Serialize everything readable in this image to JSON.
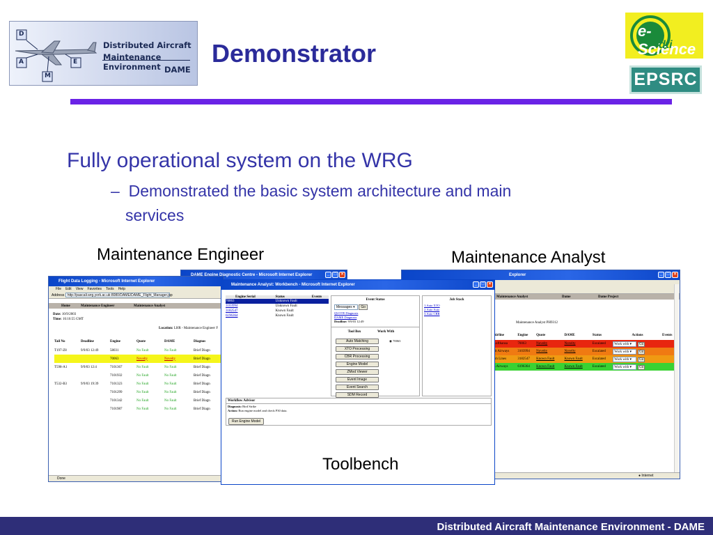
{
  "header": {
    "logo_text": [
      "Distributed Aircraft",
      "Maintenance Environment",
      "DAME"
    ],
    "logo_letters": [
      "D",
      "A",
      "M",
      "E"
    ],
    "title": "Demonstrator",
    "escience": {
      "line1": "e-Science",
      "line2": "dti"
    },
    "epsrc": "EPSRC"
  },
  "bullets": {
    "main": "Fully operational system on the WRG",
    "sub_dash": "–",
    "sub_line1": "Demonstrated the basic system architecture and main",
    "sub_line2": "services"
  },
  "captions": {
    "engineer": "Maintenance Engineer",
    "analyst": "Maintenance Analyst",
    "toolbench": "Toolbench"
  },
  "engineer_window": {
    "title": "Flight Data Logging - Microsoft Internet Explorer",
    "menu": [
      "File",
      "Edit",
      "View",
      "Favorites",
      "Tools",
      "Help"
    ],
    "address_label": "Address",
    "address": "http://pascali.wrg.york.ac.uk:8080/DAME/DAME_Flight_Manager.jsp",
    "nav": [
      "Home",
      "Maintenance Engineer",
      "Maintenance Analyst"
    ],
    "date_label": "Date:",
    "date": "10/9/2003",
    "time_label": "Time:",
    "time": "16:16:55 GMT",
    "location_label": "Location:",
    "location": "LHR - Maintenance Engineer F",
    "columns": [
      "Tail No",
      "Deadline",
      "Engine",
      "Quote",
      "DAME",
      "Diagnos"
    ],
    "rows": [
      {
        "tail": "T197-Z8",
        "deadline": "9/9/03 12:49",
        "engine": "58031",
        "quote": "No Fault",
        "dame": "No Fault",
        "diag": "Brief Diagn",
        "hl": false
      },
      {
        "tail": "",
        "deadline": "",
        "engine": "70063",
        "quote": "Novelty",
        "dame": "Novelty",
        "diag": "Brief Diagn",
        "hl": true
      },
      {
        "tail": "T598-A1",
        "deadline": "9/9/03 12:4",
        "engine": "7101367",
        "quote": "No Fault",
        "dame": "No Fault",
        "diag": "Brief Diagn",
        "hl": false
      },
      {
        "tail": "",
        "deadline": "",
        "engine": "7101932",
        "quote": "No Fault",
        "dame": "No Fault",
        "diag": "Brief Diagn",
        "hl": false
      },
      {
        "tail": "T532-B3",
        "deadline": "9/9/03 19:39",
        "engine": "7101323",
        "quote": "No Fault",
        "dame": "No Fault",
        "diag": "Brief Diagn",
        "hl": false
      },
      {
        "tail": "",
        "deadline": "",
        "engine": "7101299",
        "quote": "No Fault",
        "dame": "No Fault",
        "diag": "Brief Diagn",
        "hl": false
      },
      {
        "tail": "",
        "deadline": "",
        "engine": "7101342",
        "quote": "No Fault",
        "dame": "No Fault",
        "diag": "Brief Diagn",
        "hl": false
      },
      {
        "tail": "",
        "deadline": "",
        "engine": "7101987",
        "quote": "No Fault",
        "dame": "No Fault",
        "diag": "Brief Diagn",
        "hl": false
      }
    ],
    "status": "Done"
  },
  "diag_window": {
    "title": "DAME Engine Diagnostic Centre - Microsoft Internet Explorer"
  },
  "analyst_window": {
    "title": "Explorer",
    "nav": [
      "Maintenance Analyst",
      "Dame",
      "Dame Project"
    ],
    "heading": "Maintenance Analyst PH9312",
    "columns": [
      "Airline",
      "Engine",
      "Quote",
      "DAME",
      "Status",
      "Actions",
      "Events"
    ],
    "rows": [
      {
        "airline": "Lufthansa",
        "engine": "70063",
        "quote": "Novelty",
        "dame": "Novelty",
        "status": "Escalated",
        "action": "Work with",
        "go": "Go",
        "color": "#e8260f"
      },
      {
        "airline": "rit Airways",
        "engine": "3103994",
        "quote": "Novelty",
        "dame": "Novelty",
        "status": "Escalated",
        "action": "Work with",
        "go": "Go",
        "color": "#f07a12"
      },
      {
        "airline": "ish Lines",
        "engine": "3182547",
        "quote": "Known Fault",
        "dame": "Known Fault",
        "status": "Escalated",
        "action": "Work with",
        "go": "Go",
        "color": "#f09a12"
      },
      {
        "airline": "n Airways",
        "engine": "6196364",
        "quote": "Known Fault",
        "dame": "Known Fault",
        "status": "Escalated",
        "action": "Work with",
        "go": "Go",
        "color": "#39d233"
      }
    ],
    "status": "Internet"
  },
  "toolbench_window": {
    "title": "Maintenance Analyst: Workbench - Microsoft Internet Explorer",
    "engine_cols": [
      "Engine Serial",
      "Status",
      "Events"
    ],
    "engines": [
      {
        "serial": "70063",
        "status": "Unknown Fault",
        "sel": true
      },
      {
        "serial": "3103994",
        "status": "Unknown Fault",
        "sel": false
      },
      {
        "serial": "3182547",
        "status": "Known Fault",
        "sel": false
      },
      {
        "serial": "6196364",
        "status": "Known Fault",
        "sel": false
      }
    ],
    "event_status_title": "Event Status",
    "messages_select": "Messages",
    "go": "Go",
    "links": [
      "QUOTE Diagnosis",
      "DAME Diagnosis"
    ],
    "deadline_label": "Deadline:",
    "deadline": "9/9/03 12:49",
    "tool_box": "Tool Box",
    "work_with": "Work With",
    "radio_value": "70063",
    "tools": [
      "Auto Matching",
      "XTO Processing",
      "CBR Processing",
      "Engine Model",
      "ZMod Viewer",
      "Event Image",
      "Event Search",
      "SDM Record"
    ],
    "job_stack_title": "Job Stack",
    "jobs": [
      "1.Auto XTO",
      "2.Auto Auto",
      "3.Auto CBR"
    ],
    "advisor_title": "Workflow Advisor",
    "diagnosis_label": "Diagnosis:",
    "diagnosis": "Bird Strike",
    "action_label": "Action:",
    "action": "Run engine model and check P30 data.",
    "run_button": "Run Engine Model"
  },
  "footer": "Distributed Aircraft Maintenance Environment - DAME",
  "colors": {
    "title": "#2b2b9a",
    "body_text": "#3434a8",
    "rule": "#6a22e6",
    "footer_bg": "#2e2e78",
    "xp_title": "#0a45c8"
  }
}
